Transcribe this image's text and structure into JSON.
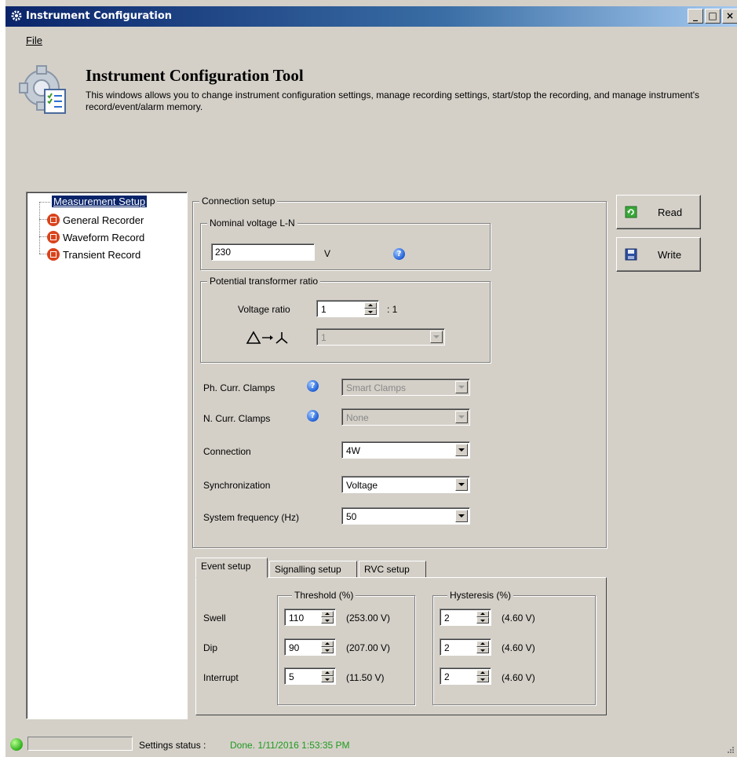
{
  "window": {
    "title": "Instrument Configuration"
  },
  "menu": {
    "file": "File"
  },
  "header": {
    "title": "Instrument Configuration Tool",
    "description": "This windows allows you to change instrument configuration settings, manage recording settings, start/stop the recording, and manage instrument's record/event/alarm memory."
  },
  "tree": {
    "root": "Measurement Setup",
    "items": [
      {
        "label": "General Recorder"
      },
      {
        "label": "Waveform Record"
      },
      {
        "label": "Transient Record"
      }
    ]
  },
  "connection": {
    "group_label": "Connection setup",
    "nominal_voltage": {
      "group_label": "Nominal voltage L-N",
      "value": "230",
      "unit": "V"
    },
    "pt_ratio": {
      "group_label": "Potential transformer ratio",
      "voltage_ratio_label": "Voltage ratio",
      "voltage_ratio_value": "1",
      "voltage_ratio_suffix": ": 1",
      "delta_wye_value": "1"
    },
    "ph_clamps": {
      "label": "Ph. Curr. Clamps",
      "value": "Smart Clamps"
    },
    "n_clamps": {
      "label": "N. Curr. Clamps",
      "value": "None"
    },
    "connection": {
      "label": "Connection",
      "value": "4W"
    },
    "synchronization": {
      "label": "Synchronization",
      "value": "Voltage"
    },
    "frequency": {
      "label": "System frequency (Hz)",
      "value": "50"
    }
  },
  "buttons": {
    "read": "Read",
    "write": "Write"
  },
  "tabs": [
    "Event setup",
    "Signalling setup",
    "RVC setup"
  ],
  "event_setup": {
    "threshold_label": "Threshold (%)",
    "hysteresis_label": "Hysteresis (%)",
    "rows": [
      {
        "name": "Swell",
        "threshold": "110",
        "threshold_v": "(253.00 V)",
        "hysteresis": "2",
        "hysteresis_v": "(4.60 V)"
      },
      {
        "name": "Dip",
        "threshold": "90",
        "threshold_v": "(207.00 V)",
        "hysteresis": "2",
        "hysteresis_v": "(4.60 V)"
      },
      {
        "name": "Interrupt",
        "threshold": "5",
        "threshold_v": "(11.50 V)",
        "hysteresis": "2",
        "hysteresis_v": "(4.60 V)"
      }
    ]
  },
  "status": {
    "label": "Settings status :",
    "value": "Done. 1/11/2016 1:53:35 PM"
  },
  "colors": {
    "status_ok": "#1f9a1f",
    "title_bar": "#0a246a",
    "tree_item_icon": "#d9431c"
  }
}
